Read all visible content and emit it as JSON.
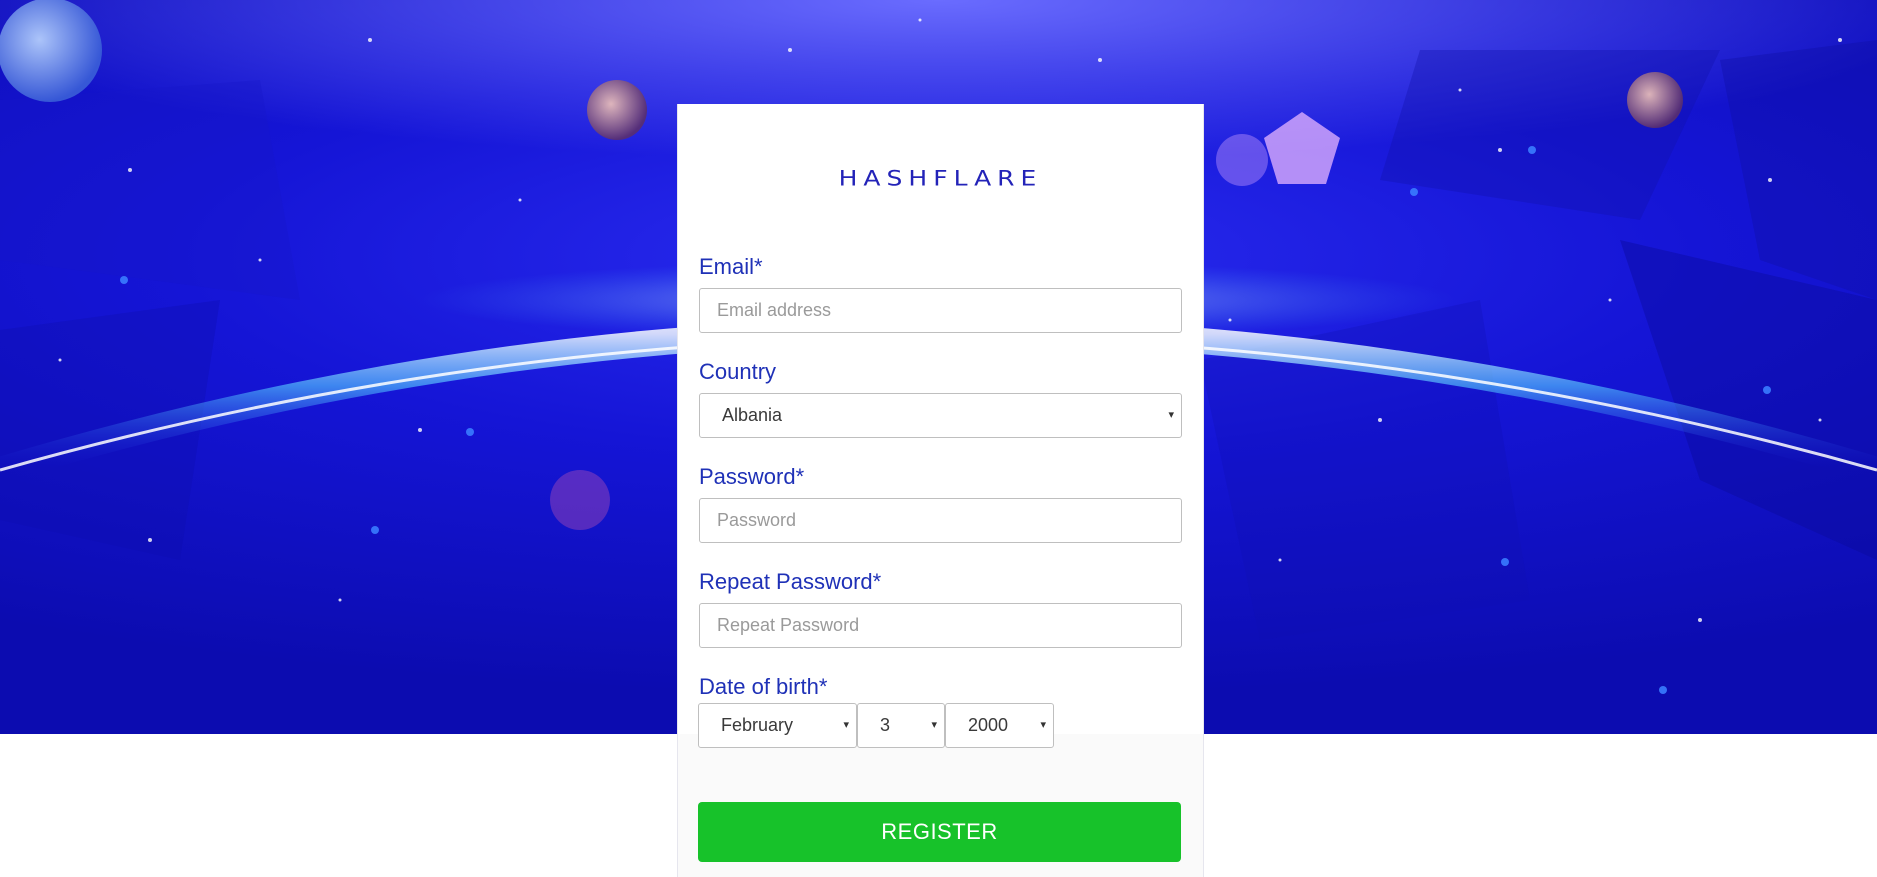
{
  "brand": {
    "logo_text": "HASHFLARE"
  },
  "form": {
    "email": {
      "label": "Email*",
      "placeholder": "Email address"
    },
    "country": {
      "label": "Country",
      "selected": "Albania"
    },
    "password": {
      "label": "Password*",
      "placeholder": "Password"
    },
    "repeat_password": {
      "label": "Repeat Password*",
      "placeholder": "Repeat Password"
    },
    "dob": {
      "label": "Date of birth*",
      "month": "February",
      "day": "3",
      "year": "2000"
    },
    "submit_label": "REGISTER"
  },
  "colors": {
    "label": "#1f31b7",
    "logo": "#2323b8",
    "register_button": "#17c22a",
    "hero_background": "#1515d6"
  },
  "icons": {
    "select_caret": "▾"
  }
}
